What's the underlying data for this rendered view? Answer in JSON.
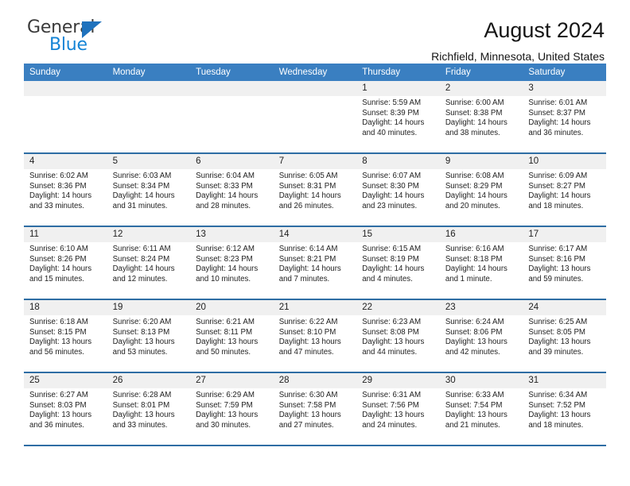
{
  "brand": {
    "name_top": "General",
    "name_bottom": "Blue",
    "triangle_color": "#1f72bd",
    "blue_text_color": "#1484d6"
  },
  "header": {
    "title": "August 2024",
    "location": "Richfield, Minnesota, United States"
  },
  "colors": {
    "header_row_bg": "#3a7fc1",
    "row_separator": "#2e6da4",
    "day_number_bg": "#f0f0f0"
  },
  "weekdays": [
    "Sunday",
    "Monday",
    "Tuesday",
    "Wednesday",
    "Thursday",
    "Friday",
    "Saturday"
  ],
  "labels": {
    "sunrise": "Sunrise:",
    "sunset": "Sunset:",
    "daylight": "Daylight:"
  },
  "weeks": [
    [
      {
        "day": ""
      },
      {
        "day": ""
      },
      {
        "day": ""
      },
      {
        "day": ""
      },
      {
        "day": "1",
        "sunrise": "Sunrise: 5:59 AM",
        "sunset": "Sunset: 8:39 PM",
        "daylight": "Daylight: 14 hours and 40 minutes."
      },
      {
        "day": "2",
        "sunrise": "Sunrise: 6:00 AM",
        "sunset": "Sunset: 8:38 PM",
        "daylight": "Daylight: 14 hours and 38 minutes."
      },
      {
        "day": "3",
        "sunrise": "Sunrise: 6:01 AM",
        "sunset": "Sunset: 8:37 PM",
        "daylight": "Daylight: 14 hours and 36 minutes."
      }
    ],
    [
      {
        "day": "4",
        "sunrise": "Sunrise: 6:02 AM",
        "sunset": "Sunset: 8:36 PM",
        "daylight": "Daylight: 14 hours and 33 minutes."
      },
      {
        "day": "5",
        "sunrise": "Sunrise: 6:03 AM",
        "sunset": "Sunset: 8:34 PM",
        "daylight": "Daylight: 14 hours and 31 minutes."
      },
      {
        "day": "6",
        "sunrise": "Sunrise: 6:04 AM",
        "sunset": "Sunset: 8:33 PM",
        "daylight": "Daylight: 14 hours and 28 minutes."
      },
      {
        "day": "7",
        "sunrise": "Sunrise: 6:05 AM",
        "sunset": "Sunset: 8:31 PM",
        "daylight": "Daylight: 14 hours and 26 minutes."
      },
      {
        "day": "8",
        "sunrise": "Sunrise: 6:07 AM",
        "sunset": "Sunset: 8:30 PM",
        "daylight": "Daylight: 14 hours and 23 minutes."
      },
      {
        "day": "9",
        "sunrise": "Sunrise: 6:08 AM",
        "sunset": "Sunset: 8:29 PM",
        "daylight": "Daylight: 14 hours and 20 minutes."
      },
      {
        "day": "10",
        "sunrise": "Sunrise: 6:09 AM",
        "sunset": "Sunset: 8:27 PM",
        "daylight": "Daylight: 14 hours and 18 minutes."
      }
    ],
    [
      {
        "day": "11",
        "sunrise": "Sunrise: 6:10 AM",
        "sunset": "Sunset: 8:26 PM",
        "daylight": "Daylight: 14 hours and 15 minutes."
      },
      {
        "day": "12",
        "sunrise": "Sunrise: 6:11 AM",
        "sunset": "Sunset: 8:24 PM",
        "daylight": "Daylight: 14 hours and 12 minutes."
      },
      {
        "day": "13",
        "sunrise": "Sunrise: 6:12 AM",
        "sunset": "Sunset: 8:23 PM",
        "daylight": "Daylight: 14 hours and 10 minutes."
      },
      {
        "day": "14",
        "sunrise": "Sunrise: 6:14 AM",
        "sunset": "Sunset: 8:21 PM",
        "daylight": "Daylight: 14 hours and 7 minutes."
      },
      {
        "day": "15",
        "sunrise": "Sunrise: 6:15 AM",
        "sunset": "Sunset: 8:19 PM",
        "daylight": "Daylight: 14 hours and 4 minutes."
      },
      {
        "day": "16",
        "sunrise": "Sunrise: 6:16 AM",
        "sunset": "Sunset: 8:18 PM",
        "daylight": "Daylight: 14 hours and 1 minute."
      },
      {
        "day": "17",
        "sunrise": "Sunrise: 6:17 AM",
        "sunset": "Sunset: 8:16 PM",
        "daylight": "Daylight: 13 hours and 59 minutes."
      }
    ],
    [
      {
        "day": "18",
        "sunrise": "Sunrise: 6:18 AM",
        "sunset": "Sunset: 8:15 PM",
        "daylight": "Daylight: 13 hours and 56 minutes."
      },
      {
        "day": "19",
        "sunrise": "Sunrise: 6:20 AM",
        "sunset": "Sunset: 8:13 PM",
        "daylight": "Daylight: 13 hours and 53 minutes."
      },
      {
        "day": "20",
        "sunrise": "Sunrise: 6:21 AM",
        "sunset": "Sunset: 8:11 PM",
        "daylight": "Daylight: 13 hours and 50 minutes."
      },
      {
        "day": "21",
        "sunrise": "Sunrise: 6:22 AM",
        "sunset": "Sunset: 8:10 PM",
        "daylight": "Daylight: 13 hours and 47 minutes."
      },
      {
        "day": "22",
        "sunrise": "Sunrise: 6:23 AM",
        "sunset": "Sunset: 8:08 PM",
        "daylight": "Daylight: 13 hours and 44 minutes."
      },
      {
        "day": "23",
        "sunrise": "Sunrise: 6:24 AM",
        "sunset": "Sunset: 8:06 PM",
        "daylight": "Daylight: 13 hours and 42 minutes."
      },
      {
        "day": "24",
        "sunrise": "Sunrise: 6:25 AM",
        "sunset": "Sunset: 8:05 PM",
        "daylight": "Daylight: 13 hours and 39 minutes."
      }
    ],
    [
      {
        "day": "25",
        "sunrise": "Sunrise: 6:27 AM",
        "sunset": "Sunset: 8:03 PM",
        "daylight": "Daylight: 13 hours and 36 minutes."
      },
      {
        "day": "26",
        "sunrise": "Sunrise: 6:28 AM",
        "sunset": "Sunset: 8:01 PM",
        "daylight": "Daylight: 13 hours and 33 minutes."
      },
      {
        "day": "27",
        "sunrise": "Sunrise: 6:29 AM",
        "sunset": "Sunset: 7:59 PM",
        "daylight": "Daylight: 13 hours and 30 minutes."
      },
      {
        "day": "28",
        "sunrise": "Sunrise: 6:30 AM",
        "sunset": "Sunset: 7:58 PM",
        "daylight": "Daylight: 13 hours and 27 minutes."
      },
      {
        "day": "29",
        "sunrise": "Sunrise: 6:31 AM",
        "sunset": "Sunset: 7:56 PM",
        "daylight": "Daylight: 13 hours and 24 minutes."
      },
      {
        "day": "30",
        "sunrise": "Sunrise: 6:33 AM",
        "sunset": "Sunset: 7:54 PM",
        "daylight": "Daylight: 13 hours and 21 minutes."
      },
      {
        "day": "31",
        "sunrise": "Sunrise: 6:34 AM",
        "sunset": "Sunset: 7:52 PM",
        "daylight": "Daylight: 13 hours and 18 minutes."
      }
    ]
  ]
}
